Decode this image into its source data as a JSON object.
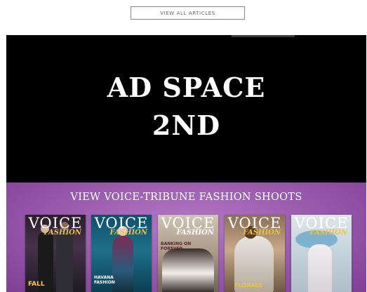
{
  "top": {
    "view_all_label": "VIEW ALL ARTICLES"
  },
  "ad": {
    "line1": "AD SPACE",
    "line2": "2ND"
  },
  "fashion": {
    "heading": "VIEW VOICE-TRIBUNE FASHION SHOOTS",
    "covers": [
      {
        "masthead": "VOICE",
        "section": "FASHION",
        "tagline": "FALL"
      },
      {
        "masthead": "VOICE",
        "section": "FASHION",
        "tagline": "HAVANA FASHION"
      },
      {
        "masthead": "VOICE",
        "section": "FASHION",
        "tagline": "BANKING ON FOREVER"
      },
      {
        "masthead": "VOICE",
        "section": "FASHION",
        "tagline": "FLORALS"
      },
      {
        "masthead": "VOICE",
        "section": "FASHION",
        "tagline": ""
      }
    ]
  }
}
